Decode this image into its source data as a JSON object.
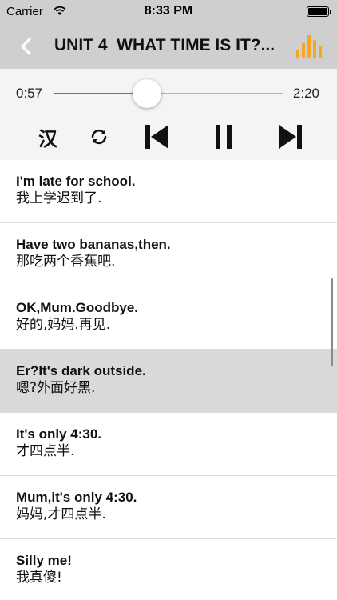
{
  "status_bar": {
    "carrier": "Carrier",
    "time": "8:33 PM",
    "wifi_icon": "wifi-icon",
    "battery_icon": "battery-icon"
  },
  "nav": {
    "title": "UNIT 4  WHAT TIME IS IT?...",
    "back_icon": "chevron-left-icon",
    "chart_icon": "bar-chart-icon",
    "accent": "#f5a623"
  },
  "player": {
    "elapsed": "0:57",
    "total": "2:20",
    "progress": 0.407,
    "language_toggle": "汉",
    "slider_color": "#1a8fe0",
    "controls": [
      "repeat-icon",
      "skip-previous-icon",
      "pause-icon",
      "skip-next-icon"
    ]
  },
  "sentences": [
    {
      "en": "I'm late for school.",
      "zh": "我上学迟到了.",
      "selected": false
    },
    {
      "en": "Have two bananas,then.",
      "zh": "那吃两个香蕉吧.",
      "selected": false
    },
    {
      "en": "OK,Mum.Goodbye.",
      "zh": "好的,妈妈.再见.",
      "selected": false
    },
    {
      "en": "Er?It's dark outside.",
      "zh": "嗯?外面好黑.",
      "selected": true
    },
    {
      "en": "It's only 4:30.",
      "zh": "才四点半.",
      "selected": false
    },
    {
      "en": "Mum,it's only 4:30.",
      "zh": "妈妈,才四点半.",
      "selected": false
    },
    {
      "en": "Silly me!",
      "zh": "我真傻!",
      "selected": false
    }
  ]
}
